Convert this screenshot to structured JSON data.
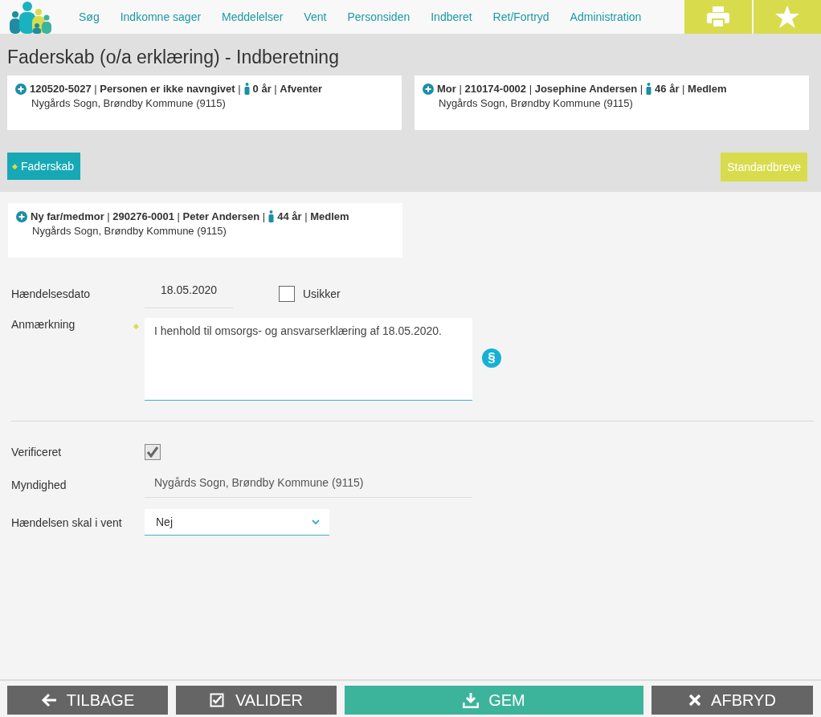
{
  "nav": {
    "items": [
      "Søg",
      "Indkomne sager",
      "Meddelelser",
      "Vent",
      "Personsiden",
      "Indberet",
      "Ret/Fortryd",
      "Administration"
    ]
  },
  "title": "Faderskab (o/a erklæring) - Indberetning",
  "person_cards": [
    {
      "before_icon": "**120520-5027** | **Personen er ikke navngivet** |",
      "after_icon": "**0 år** | **Afventer**",
      "address": "Nygårds Sogn, Brøndby Kommune (9115)"
    },
    {
      "before_icon": "**Mor** | **210174-0002** | **Josephine Andersen** |",
      "after_icon": "**46 år** | **Medlem**",
      "address": "Nygårds Sogn, Brøndby Kommune (9115)"
    }
  ],
  "case_tab": {
    "marker": "◆",
    "label": "Faderskab"
  },
  "letters_button": "Standardbreve",
  "new_parent_card": {
    "before_icon": "**Ny far/medmor** | **290276-0001** | **Peter Andersen** |",
    "after_icon": "**44 år** | **Medlem**",
    "address": "Nygårds Sogn, Brøndby Kommune (9115)"
  },
  "form": {
    "date_label": "Hændelsesdato",
    "date_value": "18.05.2020",
    "uncertain_label": "Usikker",
    "uncertain_checked": false,
    "remark_label": "Anmærkning",
    "remark_marker": "◆",
    "remark_value": "I henhold til omsorgs- og ansvarserklæring af 18.05.2020.",
    "paragraph_icon": "§",
    "verified_label": "Verificeret",
    "verified_checked": true,
    "authority_label": "Myndighed",
    "authority_value": "Nygårds Sogn, Brøndby Kommune (9115)",
    "wait_label": "Hændelsen skal i vent",
    "wait_value": "Nej"
  },
  "footer_buttons": [
    {
      "kind": "back",
      "label": "TILBAGE"
    },
    {
      "kind": "validate",
      "label": "VALIDER"
    },
    {
      "kind": "save",
      "label": "GEM"
    },
    {
      "kind": "cancel",
      "label": "AFBRYD"
    }
  ]
}
